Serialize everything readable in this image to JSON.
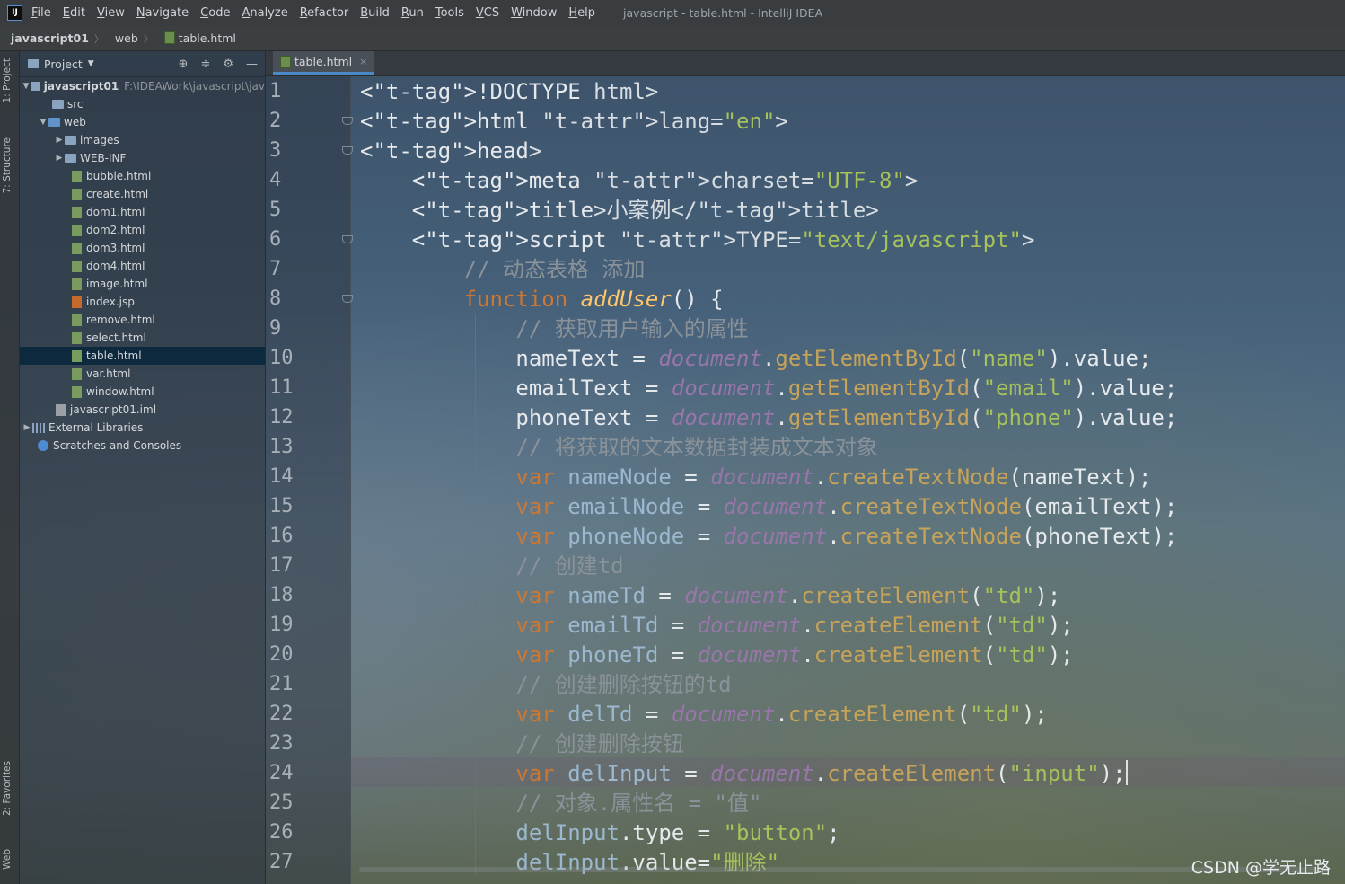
{
  "menubar": {
    "logo": "IJ",
    "items": [
      "File",
      "Edit",
      "View",
      "Navigate",
      "Code",
      "Analyze",
      "Refactor",
      "Build",
      "Run",
      "Tools",
      "VCS",
      "Window",
      "Help"
    ],
    "window_title": "javascript - table.html - IntelliJ IDEA"
  },
  "navbar": {
    "project": "javascript01",
    "folder": "web",
    "file": "table.html"
  },
  "left_strip": {
    "project_tab": "1: Project",
    "structure_tab": "7: Structure",
    "favorites_tab": "2: Favorites",
    "web_tab": "Web"
  },
  "project_panel": {
    "title": "Project",
    "root": {
      "name": "javascript01",
      "path": "F:\\IDEAWork\\javascript\\jav"
    },
    "items": [
      {
        "label": "src",
        "kind": "folder"
      },
      {
        "label": "web",
        "kind": "webfolder"
      },
      {
        "label": "images",
        "kind": "folder"
      },
      {
        "label": "WEB-INF",
        "kind": "folder"
      },
      {
        "label": "bubble.html",
        "kind": "html"
      },
      {
        "label": "create.html",
        "kind": "html"
      },
      {
        "label": "dom1.html",
        "kind": "html"
      },
      {
        "label": "dom2.html",
        "kind": "html"
      },
      {
        "label": "dom3.html",
        "kind": "html"
      },
      {
        "label": "dom4.html",
        "kind": "html"
      },
      {
        "label": "image.html",
        "kind": "html"
      },
      {
        "label": "index.jsp",
        "kind": "jsp"
      },
      {
        "label": "remove.html",
        "kind": "html"
      },
      {
        "label": "select.html",
        "kind": "html"
      },
      {
        "label": "table.html",
        "kind": "html"
      },
      {
        "label": "var.html",
        "kind": "html"
      },
      {
        "label": "window.html",
        "kind": "html"
      },
      {
        "label": "javascript01.iml",
        "kind": "iml"
      },
      {
        "label": "External Libraries",
        "kind": "lib"
      },
      {
        "label": "Scratches and Consoles",
        "kind": "scratch"
      }
    ],
    "selected": "table.html"
  },
  "editor": {
    "tab_label": "table.html",
    "line_numbers": [
      "1",
      "2",
      "3",
      "4",
      "5",
      "6",
      "7",
      "8",
      "9",
      "10",
      "11",
      "12",
      "13",
      "14",
      "15",
      "16",
      "17",
      "18",
      "19",
      "20",
      "21",
      "22",
      "23",
      "24",
      "25",
      "26",
      "27"
    ],
    "lines": [
      "<!DOCTYPE html>",
      "<html lang=\"en\">",
      "<head>",
      "    <meta charset=\"UTF-8\">",
      "    <title>小案例</title>",
      "    <script TYPE=\"text/javascript\">",
      "        // 动态表格 添加",
      "        function addUser() {",
      "            // 获取用户输入的属性",
      "            nameText = document.getElementById(\"name\").value;",
      "            emailText = document.getElementById(\"email\").value;",
      "            phoneText = document.getElementById(\"phone\").value;",
      "            // 将获取的文本数据封装成文本对象",
      "            var nameNode = document.createTextNode(nameText);",
      "            var emailNode = document.createTextNode(emailText);",
      "            var phoneNode = document.createTextNode(phoneText);",
      "            // 创建td",
      "            var nameTd = document.createElement(\"td\");",
      "            var emailTd = document.createElement(\"td\");",
      "            var phoneTd = document.createElement(\"td\");",
      "            // 创建删除按钮的td",
      "            var delTd = document.createElement(\"td\");",
      "            // 创建删除按钮",
      "            var delInput = document.createElement(\"input\");",
      "            // 对象.属性名 = \"值\"",
      "            delInput.type = \"button\";",
      "            delInput.value=\"删除\""
    ],
    "current_line": 24
  },
  "watermark": "CSDN @学无止路"
}
